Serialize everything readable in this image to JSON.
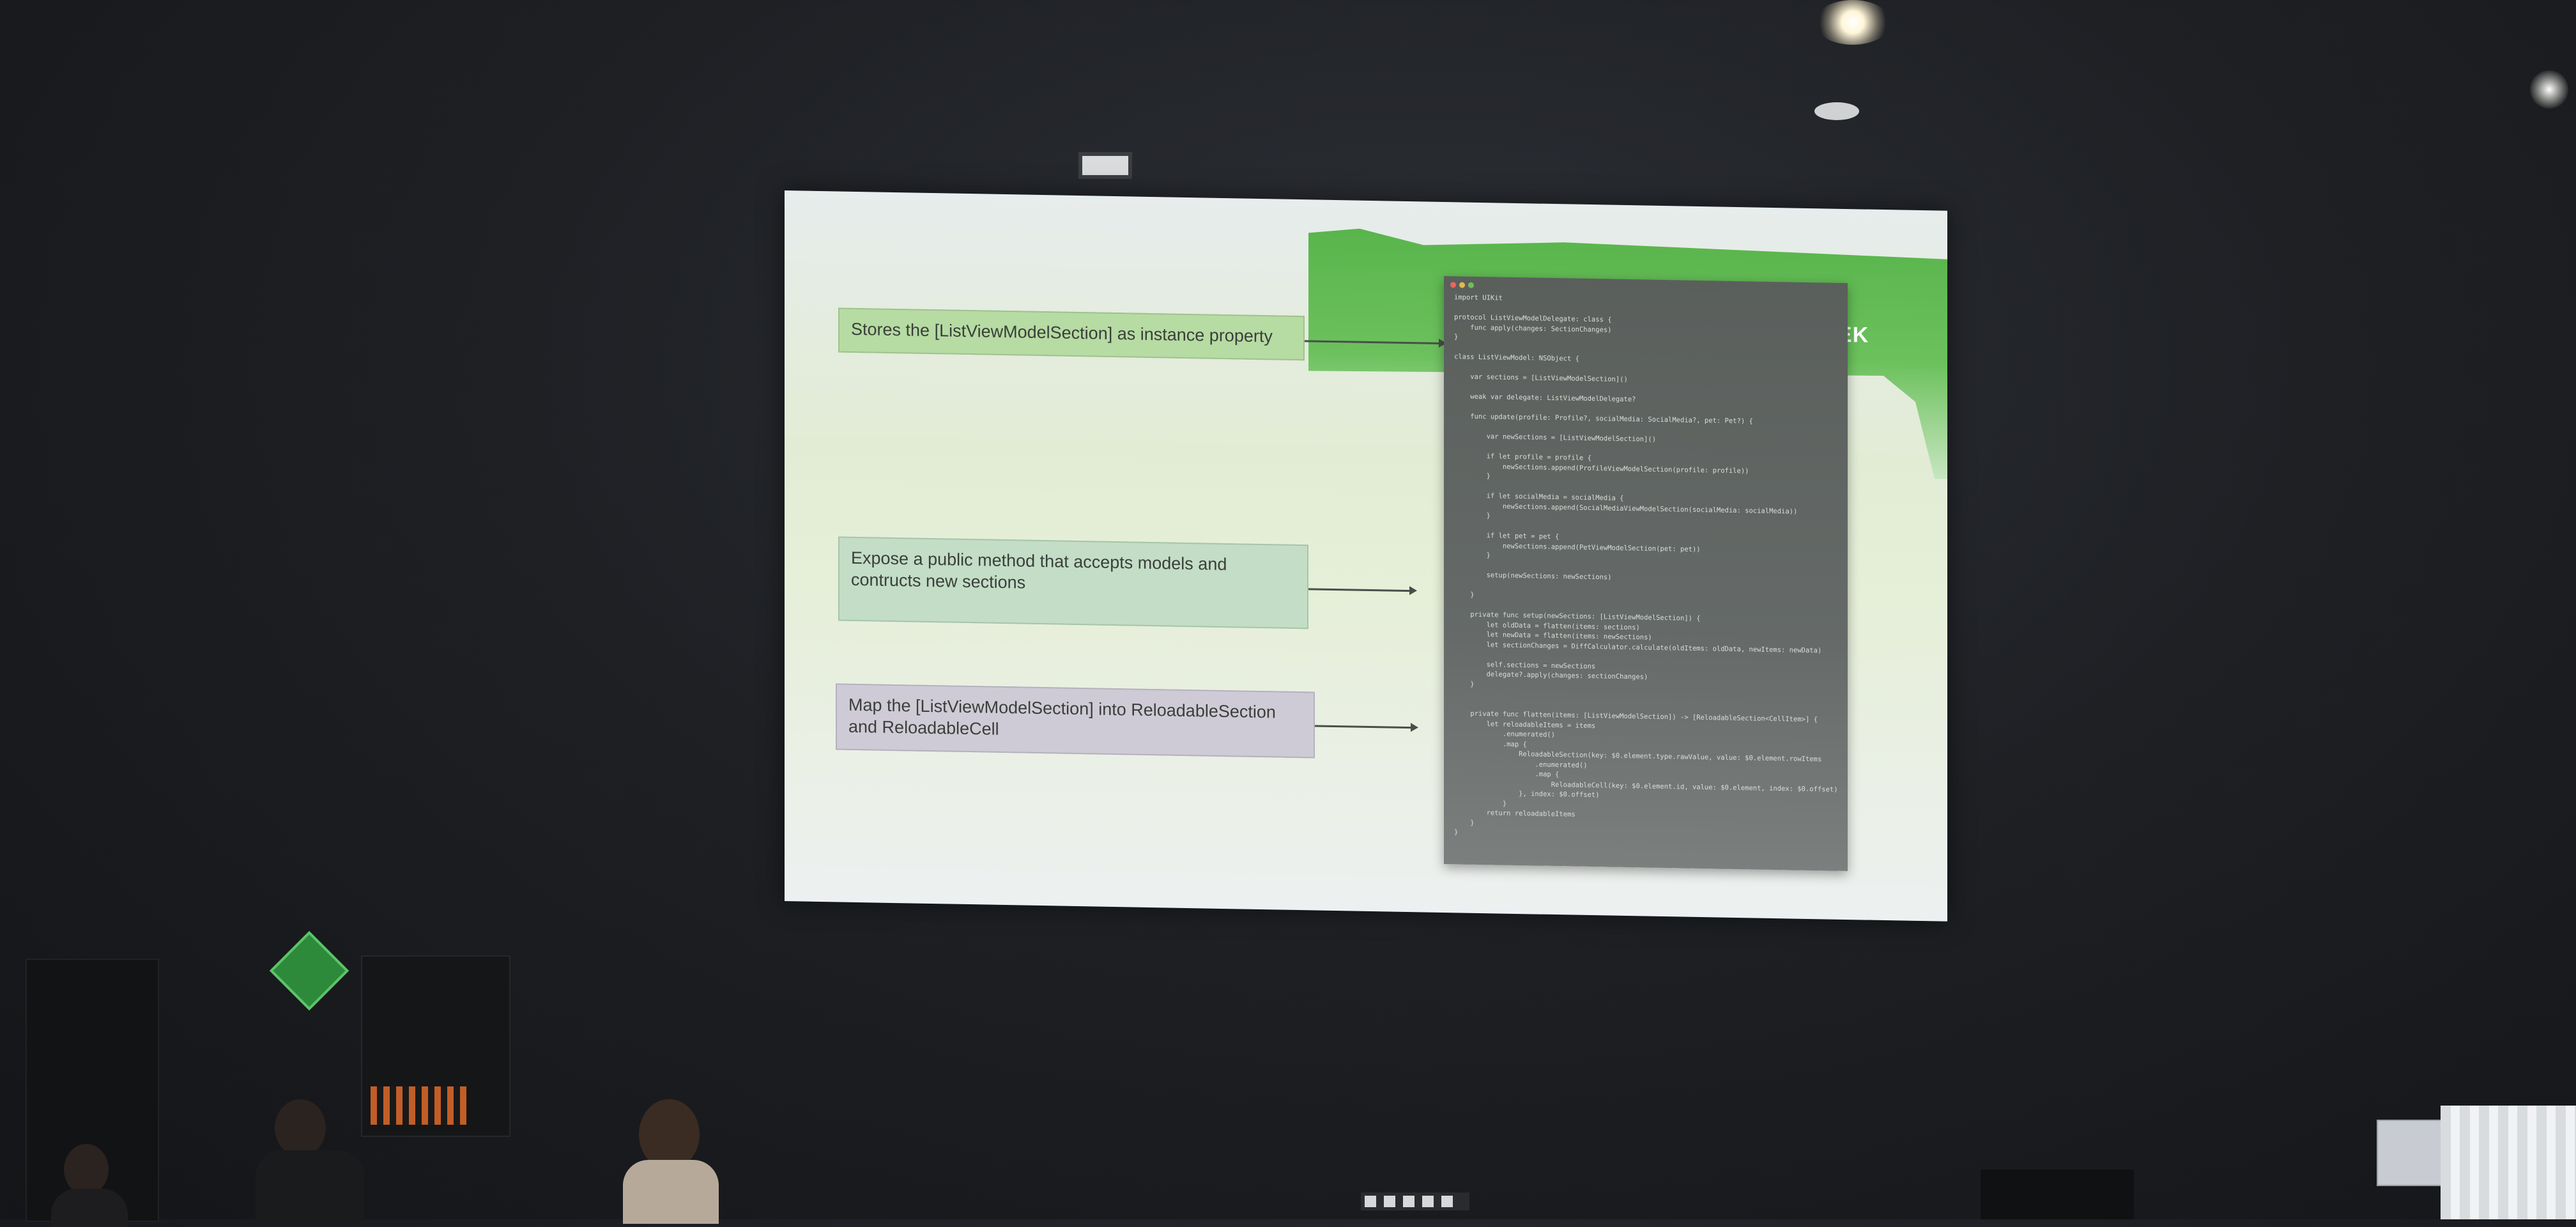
{
  "scene": {
    "description_label": "conference talk slide"
  },
  "slide": {
    "logo": "JEK",
    "callouts": [
      "Stores the [ListViewModelSection] as instance property",
      "Expose a public method that accepts models and contructs new sections",
      "Map the [ListViewModelSection] into ReloadableSection and ReloadableCell"
    ]
  },
  "code": {
    "lines": [
      "import UIKit",
      "",
      "protocol ListViewModelDelegate: class {",
      "    func apply(changes: SectionChanges)",
      "}",
      "",
      "class ListViewModel: NSObject {",
      "",
      "    var sections = [ListViewModelSection]()",
      "",
      "    weak var delegate: ListViewModelDelegate?",
      "",
      "    func update(profile: Profile?, socialMedia: SocialMedia?, pet: Pet?) {",
      "",
      "        var newSections = [ListViewModelSection]()",
      "",
      "        if let profile = profile {",
      "            newSections.append(ProfileViewModelSection(profile: profile))",
      "        }",
      "",
      "        if let socialMedia = socialMedia {",
      "            newSections.append(SocialMediaViewModelSection(socialMedia: socialMedia))",
      "        }",
      "",
      "        if let pet = pet {",
      "            newSections.append(PetViewModelSection(pet: pet))",
      "        }",
      "",
      "        setup(newSections: newSections)",
      "",
      "    }",
      "",
      "    private func setup(newSections: [ListViewModelSection]) {",
      "        let oldData = flatten(items: sections)",
      "        let newData = flatten(items: newSections)",
      "        let sectionChanges = DiffCalculator.calculate(oldItems: oldData, newItems: newData)",
      "",
      "        self.sections = newSections",
      "        delegate?.apply(changes: sectionChanges)",
      "    }",
      "",
      "",
      "    private func flatten(items: [ListViewModelSection]) -> [ReloadableSection<CellItem>] {",
      "        let reloadableItems = items",
      "            .enumerated()",
      "            .map {",
      "                ReloadableSection(key: $0.element.type.rawValue, value: $0.element.rowItems",
      "                    .enumerated()",
      "                    .map {",
      "                        ReloadableCell(key: $0.element.id, value: $0.element, index: $0.offset)",
      "                }, index: $0.offset)",
      "            }",
      "        return reloadableItems",
      "    }",
      "}"
    ]
  },
  "colors": {
    "brand_green": "#57b34a",
    "callout_green": "#b6dba3",
    "callout_mint": "#c3ddc6",
    "callout_lavender": "#cfcbd6"
  }
}
